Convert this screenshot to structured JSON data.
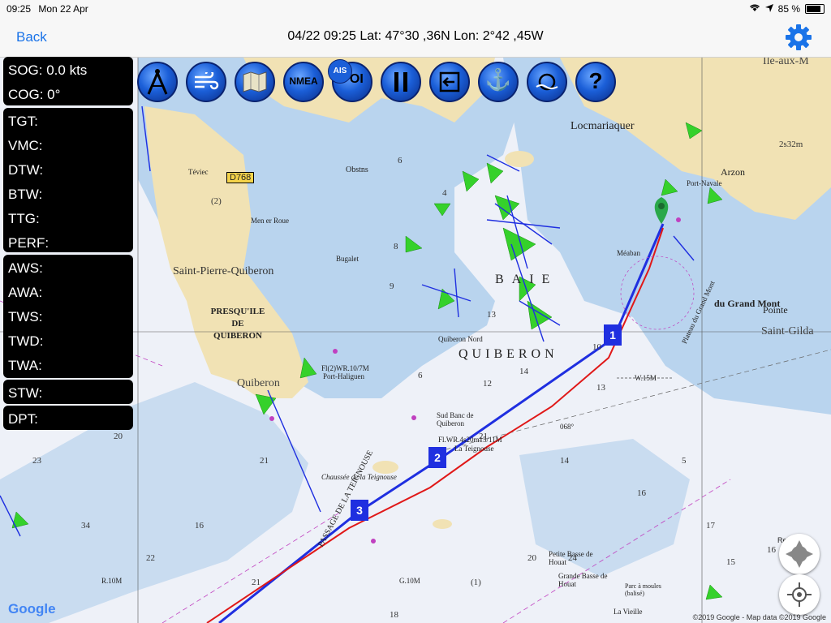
{
  "status": {
    "time": "09:25",
    "date": "Mon 22 Apr",
    "battery_text": "85 %",
    "battery_level": 0.85
  },
  "nav": {
    "back_label": "Back",
    "title": "04/22 09:25  Lat: 47°30 ,36N Lon: 2°42 ,45W"
  },
  "instruments": {
    "nav": [
      "SOG: 0.0 kts",
      "COG: 0°"
    ],
    "target": [
      "TGT:",
      "VMC:",
      "DTW:",
      "BTW:",
      "TTG:",
      "PERF:"
    ],
    "wind": [
      "AWS:",
      "AWA:",
      "TWS:",
      "TWD:",
      "TWA:"
    ],
    "stw": "STW:",
    "dpt": "DPT:"
  },
  "toolbar": {
    "buttons": [
      {
        "name": "compass",
        "label": ""
      },
      {
        "name": "wind",
        "label": ""
      },
      {
        "name": "map",
        "label": ""
      },
      {
        "name": "nmea",
        "label": "NMEA"
      },
      {
        "name": "poi",
        "label": "POI"
      },
      {
        "name": "pause",
        "label": ""
      },
      {
        "name": "exit",
        "label": ""
      },
      {
        "name": "anchor",
        "label": ""
      },
      {
        "name": "mob",
        "label": ""
      },
      {
        "name": "help",
        "label": "?"
      }
    ],
    "ais_label": "AIS"
  },
  "map": {
    "labels": [
      "Locmariaquer",
      "Arzon",
      "Port-Navale",
      "D768",
      "Saint-Pierre-Quiberon",
      "PRESQU'ILE DE QUIBERON",
      "Quiberon",
      "Port-Haliguen",
      "BAIE",
      "QUIBERON",
      "Obstns",
      "Sud Banc de Quiberon",
      "Chaussée de la Teignouse",
      "PASSAGE DE LA TEIGNOUSE",
      "Petite Basse de Houat",
      "Grande Basse de Houat",
      "Parc à moules (balisé)",
      "La Vieille",
      "du Grand Mont",
      "Pointe",
      "Saint-Gilda",
      "Plateau du Grand Mont",
      "Recherche",
      "Men er Roue",
      "Bugalet",
      "Quiberon Nord",
      "W.15M",
      "G.10M",
      "R.10M",
      "068°",
      "Fl(2)WR.10/7M",
      "Fl.WR.4s20m15/11M",
      "La Teignouse",
      "Téviec",
      "Ile-aux-M",
      "Méaban"
    ],
    "waypoints": [
      "1",
      "2",
      "3"
    ],
    "logo": "Google",
    "copyright": "©2019 Google - Map data ©2019 Google"
  },
  "colors": {
    "route_blue": "#1f2fe0",
    "track_red": "#e01818",
    "land": "#f1e2b4",
    "shallow": "#b9d4ee",
    "sea": "#eef1f8",
    "accent": "#1a73e8",
    "wind_arrow": "#35d12b"
  }
}
